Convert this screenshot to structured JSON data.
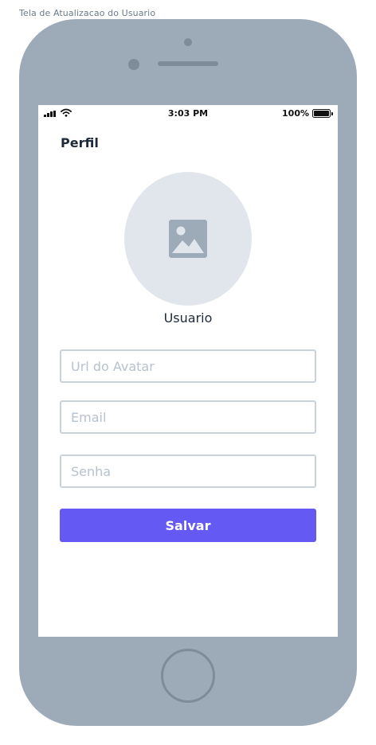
{
  "frame": {
    "label": "Tela de Atualizacao do Usuario"
  },
  "status_bar": {
    "time": "3:03 PM",
    "battery": "100%"
  },
  "header": {
    "title": "Perfil"
  },
  "profile": {
    "avatar_icon": "image-placeholder-icon",
    "username": "Usuario"
  },
  "form": {
    "avatar_url_placeholder": "Url do Avatar",
    "email_placeholder": "Email",
    "password_placeholder": "Senha",
    "avatar_url_value": "",
    "email_value": "",
    "password_value": "",
    "save_label": "Salvar"
  },
  "colors": {
    "device": "#9daab7",
    "accent": "#6459f3",
    "avatar_bg": "#e1e6ed",
    "field_border": "#c9d1db",
    "placeholder": "#b6c2cf",
    "title_text": "#1d2a3a"
  }
}
